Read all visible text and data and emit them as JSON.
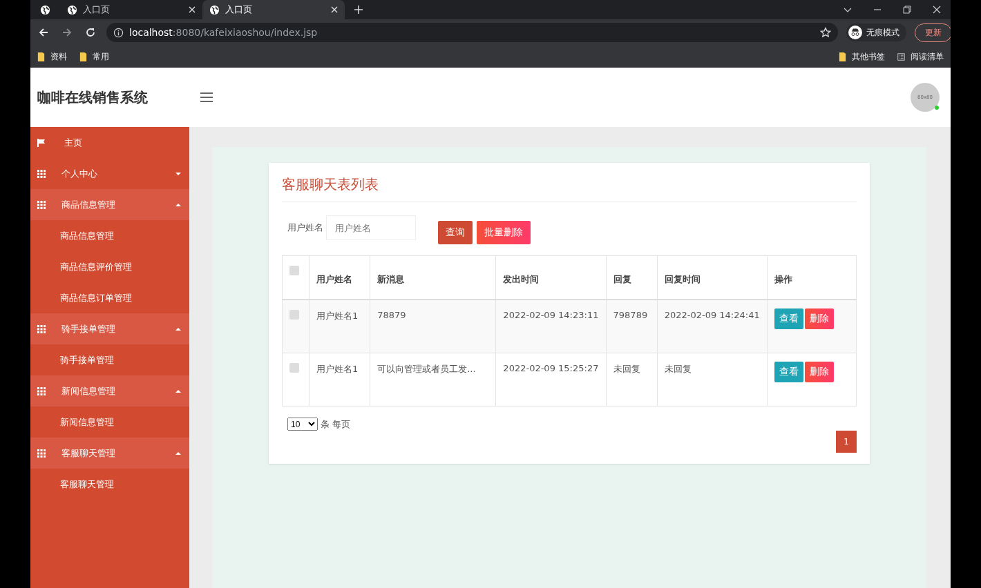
{
  "browser": {
    "tabs": [
      {
        "title": "入口页",
        "selected": false
      },
      {
        "title": "入口页",
        "selected": true
      }
    ],
    "address": {
      "host": "localhost",
      "path": ":8080/kafeixiaoshou/index.jsp"
    },
    "profile": "无痕模式",
    "update_button": "更新",
    "bookmarks": [
      "资料",
      "常用"
    ],
    "other_bookmarks": "其他书签",
    "reading_list": "阅读清单"
  },
  "app": {
    "title": "咖啡在线销售系统",
    "avatar": "80x80"
  },
  "sidebar": {
    "items": [
      {
        "kind": "link",
        "label": "主页"
      },
      {
        "kind": "group",
        "label": "个人中心",
        "expanded": false
      },
      {
        "kind": "group",
        "label": "商品信息管理",
        "expanded": true,
        "children": [
          {
            "label": "商品信息管理"
          },
          {
            "label": "商品信息评价管理"
          },
          {
            "label": "商品信息订单管理"
          }
        ]
      },
      {
        "kind": "group",
        "label": "骑手接单管理",
        "expanded": true,
        "children": [
          {
            "label": "骑手接单管理"
          }
        ]
      },
      {
        "kind": "group",
        "label": "新闻信息管理",
        "expanded": true,
        "children": [
          {
            "label": "新闻信息管理"
          }
        ]
      },
      {
        "kind": "group",
        "label": "客服聊天管理",
        "expanded": true,
        "children": [
          {
            "label": "客服聊天管理"
          }
        ]
      }
    ]
  },
  "card": {
    "title": "客服聊天表列表",
    "search": {
      "label": "用户姓名",
      "placeholder": "用户姓名"
    },
    "buttons": [
      {
        "kind": "query",
        "label": "查询"
      },
      {
        "kind": "batch_delete",
        "label": "批量删除"
      }
    ],
    "table": {
      "header_checked": false,
      "columns": [
        "用户姓名",
        "新消息",
        "发出时间",
        "回复",
        "回复时间",
        "操作"
      ],
      "rows": [
        {
          "checked": false,
          "cells": [
            "用户姓名1",
            "78879",
            "2022-02-09 14:23:11",
            "798789",
            "2022-02-09 14:24:41"
          ],
          "actions": [
            "查看",
            "删除"
          ]
        },
        {
          "checked": false,
          "cells": [
            "用户姓名1",
            "可以向管理或者员工发...",
            "2022-02-09 15:25:27",
            "未回复",
            "未回复"
          ],
          "actions": [
            "查看",
            "删除"
          ]
        }
      ]
    },
    "page_size": {
      "value": "10",
      "suffix": "条 每页"
    },
    "pages": [
      {
        "label": "1",
        "selected": true
      }
    ]
  }
}
